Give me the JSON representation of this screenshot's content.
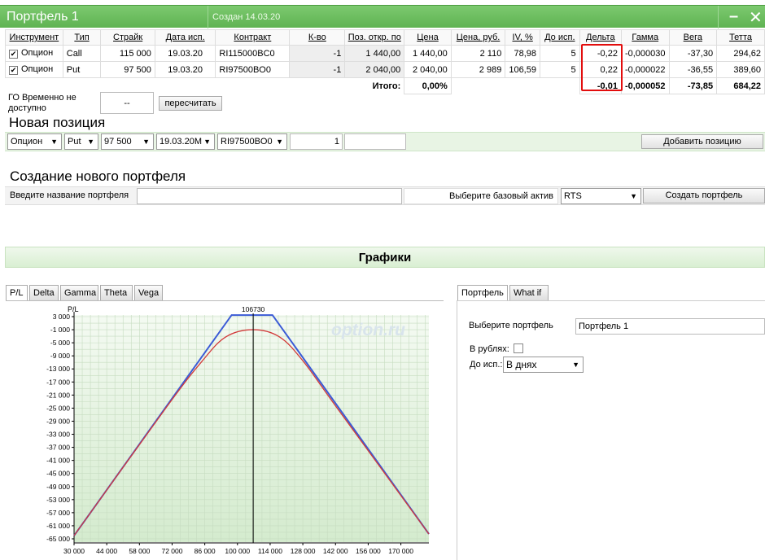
{
  "window": {
    "title": "Портфель 1",
    "created": "Создан 14.03.20"
  },
  "icons": {
    "minimize": "minimize-icon",
    "close": "close-icon"
  },
  "columns": [
    "Инструмент",
    "Тип",
    "Страйк",
    "Дата исп.",
    "Контракт",
    "К-во",
    "Поз. откр. по",
    "Цена",
    "Цена, руб.",
    "IV, %",
    "До исп.",
    "Дельта",
    "Гамма",
    "Вега",
    "Тетта"
  ],
  "rows": [
    {
      "instrument": "Опцион",
      "type": "Call",
      "strike": "115 000",
      "date": "19.03.20",
      "contract": "RI115000BC0",
      "qty": "-1",
      "open": "1 440,00",
      "price": "1 440,00",
      "price_rub": "2 110",
      "iv": "78,98",
      "days": "5",
      "delta": "-0,22",
      "gamma": "-0,000030",
      "vega": "-37,30",
      "theta": "294,62"
    },
    {
      "instrument": "Опцион",
      "type": "Put",
      "strike": "97 500",
      "date": "19.03.20",
      "contract": "RI97500BO0",
      "qty": "-1",
      "open": "2 040,00",
      "price": "2 040,00",
      "price_rub": "2 989",
      "iv": "106,59",
      "days": "5",
      "delta": "0,22",
      "gamma": "-0,000022",
      "vega": "-36,55",
      "theta": "389,60"
    }
  ],
  "totals": {
    "label": "Итого:",
    "pct": "0,00%",
    "delta": "-0,01",
    "gamma": "-0,000052",
    "vega": "-73,85",
    "theta": "684,22"
  },
  "go": {
    "label": "ГО Временно не доступно",
    "value": "--",
    "recalc": "пересчитать"
  },
  "new_position": {
    "heading": "Новая позиция",
    "instrument": "Опцион",
    "type": "Put",
    "strike": "97 500",
    "date": "19.03.20M",
    "contract": "RI97500BO0",
    "qty": "1",
    "add": "Добавить позицию"
  },
  "new_portfolio": {
    "heading": "Создание нового портфеля",
    "name_label": "Введите название портфеля",
    "asset_label": "Выберите базовый актив",
    "asset": "RTS",
    "create": "Создать портфель"
  },
  "graphs": {
    "title": "Графики",
    "tabs": [
      "P/L",
      "Delta",
      "Gamma",
      "Theta",
      "Vega"
    ],
    "watermark": "option.ru"
  },
  "right_panel": {
    "tabs": [
      "Портфель",
      "What if"
    ],
    "select_label": "Выберите портфель",
    "portfolio": "Портфель 1",
    "rubles_label": "В рублях:",
    "to_exp_label": "До исп.:",
    "to_exp": "В днях"
  },
  "chart_data": {
    "type": "line",
    "ylabel": "P/L",
    "marker_label": "106730",
    "marker_x": 106730,
    "xlim": [
      30000,
      182000
    ],
    "ylim": [
      -66000,
      3500
    ],
    "x_ticks": [
      30000,
      44000,
      58000,
      72000,
      86000,
      100000,
      114000,
      128000,
      142000,
      156000,
      170000
    ],
    "x_tick_labels": [
      "30 000",
      "44 000",
      "58 000",
      "72 000",
      "86 000",
      "100 000",
      "114 000",
      "128 000",
      "142 000",
      "156 000",
      "170 000"
    ],
    "y_ticks": [
      3000,
      -1000,
      -5000,
      -9000,
      -13000,
      -17000,
      -21000,
      -25000,
      -29000,
      -33000,
      -37000,
      -41000,
      -45000,
      -49000,
      -53000,
      -57000,
      -61000,
      -65000
    ],
    "y_tick_labels": [
      "3 000",
      "-1 000",
      "-5 000",
      "-9 000",
      "-13 000",
      "-17 000",
      "-21 000",
      "-25 000",
      "-29 000",
      "-33 000",
      "-37 000",
      "-41 000",
      "-45 000",
      "-49 000",
      "-53 000",
      "-57 000",
      "-61 000",
      "-65 000"
    ],
    "grid": true,
    "series": [
      {
        "color": "#3b5bd6",
        "points": [
          [
            30000,
            -64020
          ],
          [
            97500,
            3480
          ],
          [
            115000,
            3480
          ],
          [
            182000,
            -63520
          ]
        ]
      },
      {
        "color": "#d23a3a",
        "points": [
          [
            30000,
            -64020
          ],
          [
            70000,
            -24300
          ],
          [
            85000,
            -10500
          ],
          [
            95000,
            -3200
          ],
          [
            106730,
            -1000
          ],
          [
            118000,
            -3200
          ],
          [
            128000,
            -10500
          ],
          [
            142000,
            -24300
          ],
          [
            182000,
            -63520
          ]
        ]
      }
    ]
  }
}
